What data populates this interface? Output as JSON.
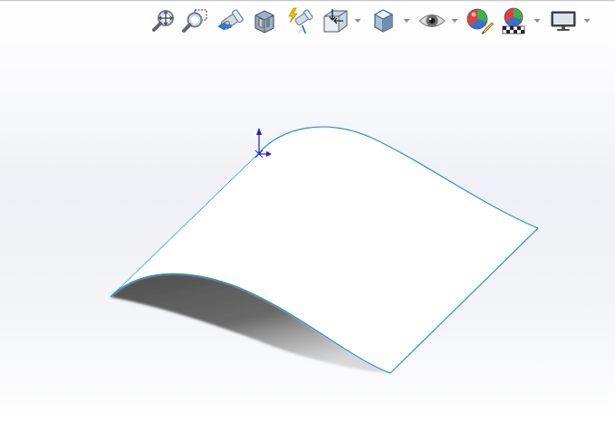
{
  "toolbar": {
    "items": [
      {
        "icon": "zoom-to-fit-icon"
      },
      {
        "icon": "zoom-to-area-icon"
      },
      {
        "icon": "previous-view-icon"
      },
      {
        "icon": "section-view-icon"
      },
      {
        "icon": "dynamic-annotation-view-icon"
      },
      {
        "icon": "view-orientation-icon",
        "has_dropdown": true
      },
      {
        "icon": "display-style-icon",
        "has_dropdown": true
      },
      {
        "icon": "hide-show-items-icon",
        "has_dropdown": true
      },
      {
        "icon": "edit-appearance-icon"
      },
      {
        "icon": "apply-scene-icon",
        "has_dropdown": true
      },
      {
        "icon": "view-settings-icon",
        "has_dropdown": true
      }
    ]
  },
  "viewport": {
    "model": "surface",
    "surface_fill": "#ffffff",
    "edge_color": "#2e8fc8",
    "shadow_color": "#5a5a5a",
    "triad": {
      "y_axis_color": "#2020c0",
      "x_axis_color": "#2020c0"
    }
  }
}
